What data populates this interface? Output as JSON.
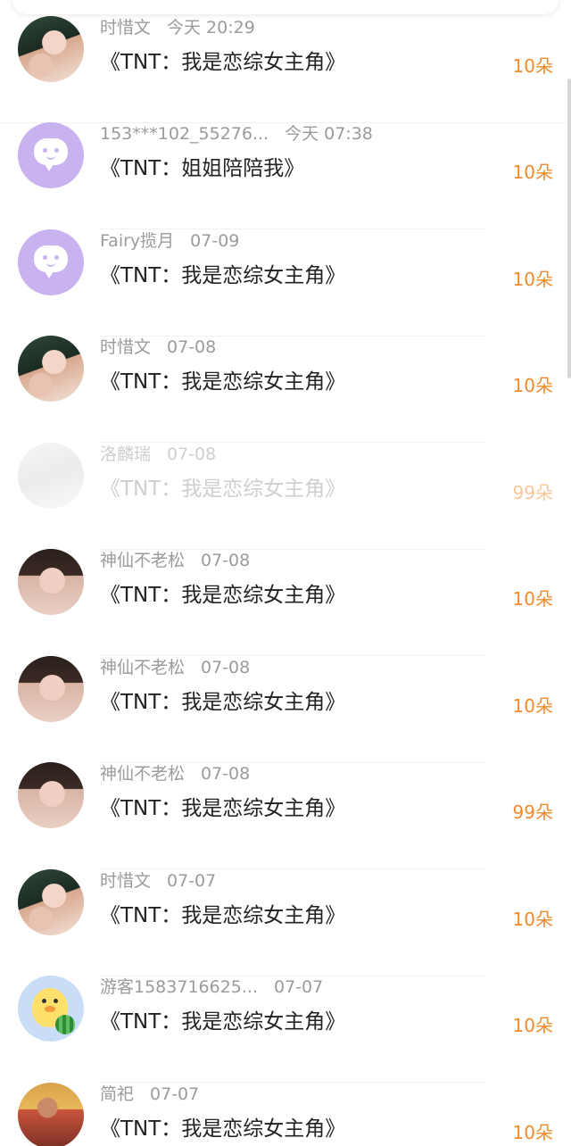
{
  "colors": {
    "gift_accent": "#f08a2a",
    "meta_gray": "#9b9b9b",
    "title_dark": "#222222",
    "avatar_purple": "#c9b2f0"
  },
  "rows": [
    {
      "user": "时惜文",
      "time": "今天 20:29",
      "title": "《TNT：我是恋综女主角》",
      "gift": "10朵",
      "avatar": "photo-girl-icon"
    },
    {
      "user": "153***102_55276...",
      "time": "今天 07:38",
      "title": "《TNT：姐姐陪陪我》",
      "gift": "10朵",
      "avatar": "chat-bubble-icon"
    },
    {
      "user": "Fairy揽月",
      "time": "07-09",
      "title": "《TNT：我是恋综女主角》",
      "gift": "10朵",
      "avatar": "chat-bubble-icon"
    },
    {
      "user": "时惜文",
      "time": "07-08",
      "title": "《TNT：我是恋综女主角》",
      "gift": "10朵",
      "avatar": "photo-girl-icon"
    },
    {
      "user": "洛麟瑞",
      "time": "07-08",
      "title": "《TNT：我是恋综女主角》",
      "gift": "99朵",
      "avatar": "photo-sketch-icon"
    },
    {
      "user": "神仙不老松",
      "time": "07-08",
      "title": "《TNT：我是恋综女主角》",
      "gift": "10朵",
      "avatar": "photo-woman-icon"
    },
    {
      "user": "神仙不老松",
      "time": "07-08",
      "title": "《TNT：我是恋综女主角》",
      "gift": "10朵",
      "avatar": "photo-woman-icon"
    },
    {
      "user": "神仙不老松",
      "time": "07-08",
      "title": "《TNT：我是恋综女主角》",
      "gift": "99朵",
      "avatar": "photo-woman-icon"
    },
    {
      "user": "时惜文",
      "time": "07-07",
      "title": "《TNT：我是恋综女主角》",
      "gift": "10朵",
      "avatar": "photo-girl-icon"
    },
    {
      "user": "游客1583716625...",
      "time": "07-07",
      "title": "《TNT：我是恋综女主角》",
      "gift": "10朵",
      "avatar": "duck-icon"
    },
    {
      "user": "简祀",
      "time": "07-07",
      "title": "《TNT：我是恋综女主角》",
      "gift": "10朵",
      "avatar": "photo-boy-icon"
    }
  ]
}
